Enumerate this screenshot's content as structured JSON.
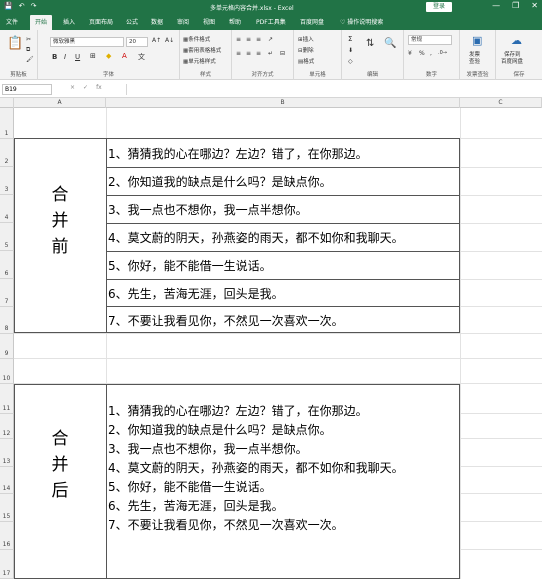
{
  "window": {
    "quick_access": [
      "💾",
      "↶",
      "↷"
    ],
    "title": "多单元格内容合并.xlsx - Excel",
    "login": "登录",
    "controls": [
      "—",
      "❐",
      "✕"
    ]
  },
  "tabs": [
    "文件",
    "开始",
    "插入",
    "页面布局",
    "公式",
    "数据",
    "审阅",
    "视图",
    "帮助",
    "PDF工具集",
    "百度网盘"
  ],
  "active_tab": "开始",
  "tell_me": "操作说明搜索",
  "ribbon": {
    "font_name": "微软雅黑",
    "font_size": "20",
    "number_format": "常规",
    "groups": [
      "剪贴板",
      "字体",
      "对齐方式",
      "数字",
      "样式",
      "单元格",
      "编辑",
      "发票查验",
      "保存"
    ],
    "styles_items": [
      "条件格式",
      "套用表格格式",
      "单元格样式"
    ],
    "cells_items": [
      "插入",
      "删除",
      "格式"
    ],
    "invoice_btn": [
      "发票",
      "查验"
    ],
    "save_btn": [
      "保存到",
      "百度网盘"
    ],
    "font_buttons": [
      "B",
      "I",
      "U"
    ]
  },
  "formula_bar": {
    "name_box": "B19",
    "icons": [
      "×",
      "✓",
      "fx"
    ],
    "value": ""
  },
  "columns": [
    "A",
    "B",
    "C"
  ],
  "rows": [
    "1",
    "2",
    "3",
    "4",
    "5",
    "6",
    "7",
    "8",
    "9",
    "10",
    "11",
    "12",
    "13",
    "14",
    "15",
    "16",
    "17"
  ],
  "sheet": {
    "label_before": [
      "合",
      "并",
      "前"
    ],
    "label_after": [
      "合",
      "并",
      "后"
    ],
    "lines": [
      "1、猜猜我的心在哪边？左边？错了，在你那边。",
      "2、你知道我的缺点是什么吗？是缺点你。",
      "3、我一点也不想你，我一点半想你。",
      "4、莫文蔚的阴天，孙燕姿的雨天，都不如你和我聊天。",
      "5、你好，能不能借一生说话。",
      "6、先生，苦海无涯，回头是我。",
      "7、不要让我看见你，不然见一次喜欢一次。"
    ]
  }
}
